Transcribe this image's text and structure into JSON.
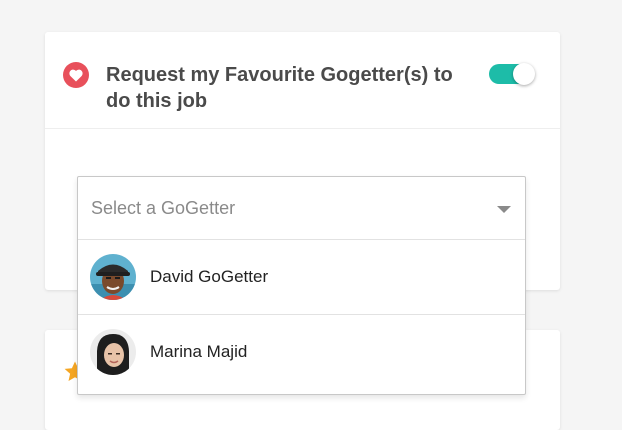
{
  "favourite_card": {
    "title": "Request my Favourite Gogetter(s) to do this job",
    "toggle_on": true,
    "accent_color": "#1dbca8",
    "heart_color": "#e8505b",
    "icon": "heart-icon"
  },
  "gogetter_select": {
    "placeholder": "Select a GoGetter",
    "options": [
      {
        "label": "David GoGetter",
        "avatar": "avatar-david"
      },
      {
        "label": "Marina Majid",
        "avatar": "avatar-marina"
      }
    ]
  },
  "second_card": {
    "icon": "star-icon",
    "icon_color": "#f5a623"
  }
}
